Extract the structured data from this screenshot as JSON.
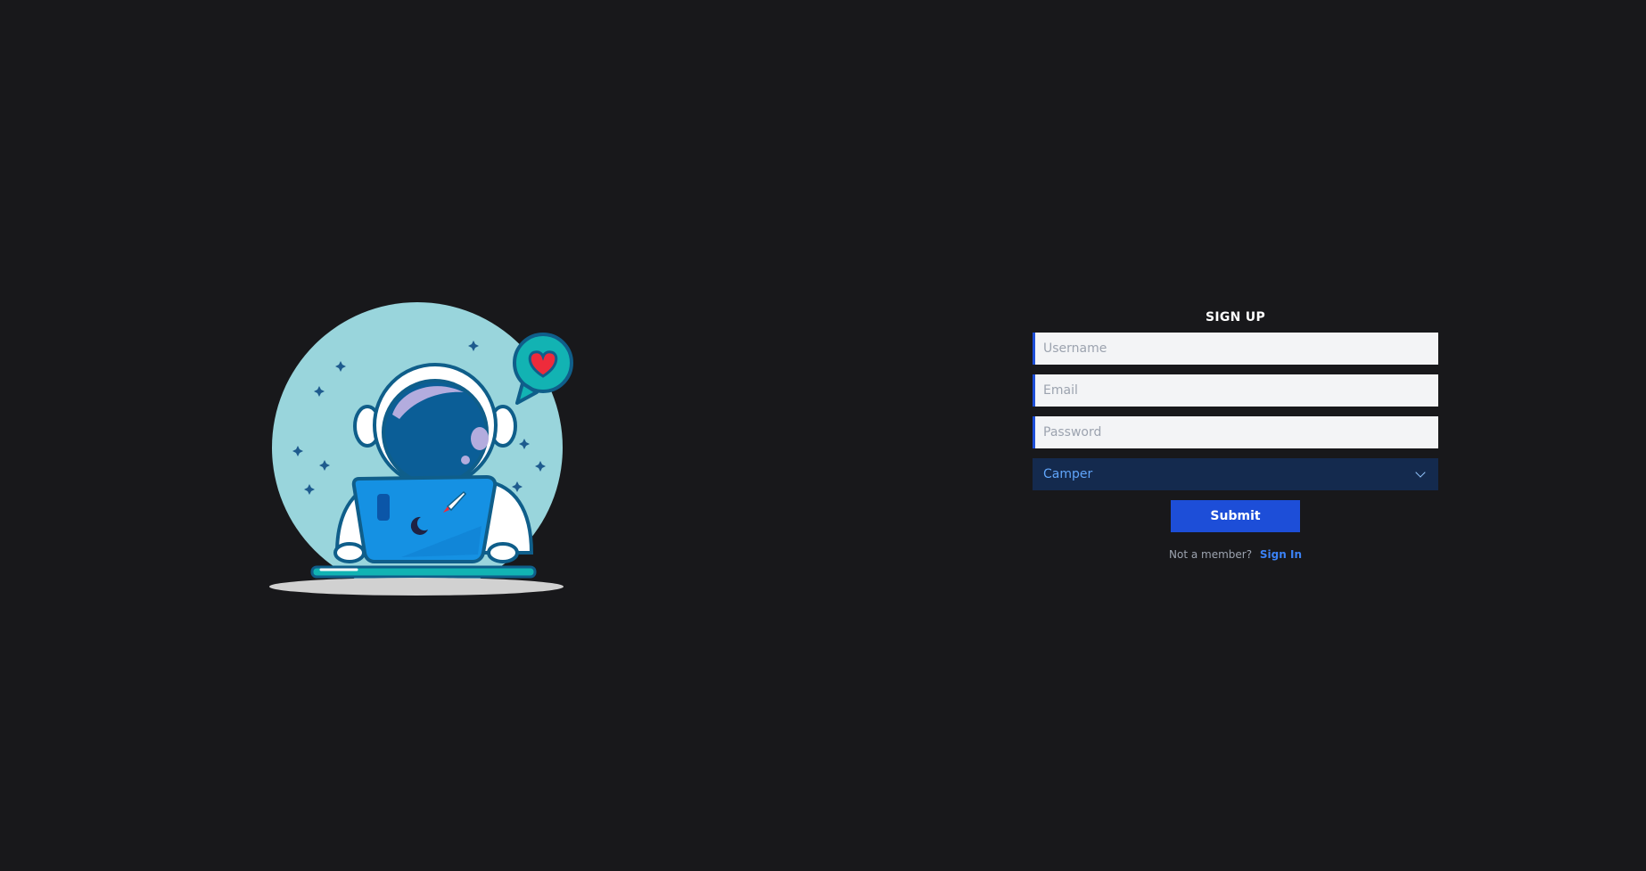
{
  "signup": {
    "title": "SIGN UP",
    "username_placeholder": "Username",
    "email_placeholder": "Email",
    "password_placeholder": "Password",
    "role_selected": "Camper",
    "submit_label": "Submit",
    "not_member_text": "Not a member?",
    "signin_link": "Sign In"
  },
  "illustration": {
    "icon": "astronaut-laptop-illustration"
  },
  "colors": {
    "background": "#18181b",
    "accent": "#1d4ed8",
    "select_bg": "#142a4e",
    "link": "#3b82f6"
  }
}
